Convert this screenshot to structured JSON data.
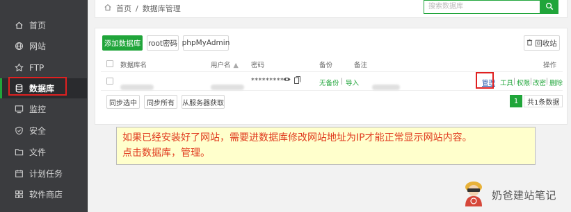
{
  "sidebar": {
    "items": [
      {
        "label": "首页",
        "icon": "home-icon"
      },
      {
        "label": "网站",
        "icon": "globe-icon"
      },
      {
        "label": "FTP",
        "icon": "ftp-icon"
      },
      {
        "label": "数据库",
        "icon": "database-icon",
        "active": true
      },
      {
        "label": "监控",
        "icon": "monitor-icon"
      },
      {
        "label": "安全",
        "icon": "shield-icon"
      },
      {
        "label": "文件",
        "icon": "folder-icon"
      },
      {
        "label": "计划任务",
        "icon": "calendar-icon"
      },
      {
        "label": "软件商店",
        "icon": "grid-icon"
      }
    ]
  },
  "breadcrumb": {
    "home": "首页",
    "separator": "/",
    "current": "数据库管理"
  },
  "search": {
    "placeholder": "搜索数据库"
  },
  "toolbar": {
    "add_db": "添加数据库",
    "root_pwd": "root密码",
    "phpmyadmin": "phpMyAdmin",
    "recycle": "回收站"
  },
  "table": {
    "headers": {
      "name": "数据库名",
      "user": "用户名",
      "password": "密码",
      "backup": "备份",
      "note": "备注",
      "actions": "操作"
    },
    "row": {
      "password": "**********",
      "backup_status": "无备份",
      "backup_sep": "|",
      "import": "导入",
      "actions": [
        "管理",
        "工具",
        "权限",
        "改密",
        "删除"
      ]
    }
  },
  "sync": {
    "selected": "同步选中",
    "all": "同步所有",
    "from_server": "从服务器获取"
  },
  "pager": {
    "page": "1",
    "total": "共1条数据"
  },
  "note": {
    "line1": "如果已经安装好了网站，需要进数据库修改网站地址为IP才能正常显示网站内容。",
    "line2": "点击数据库，管理。"
  },
  "watermark": {
    "text": "奶爸建站笔记"
  },
  "colors": {
    "brand_green": "#20a53a",
    "sidebar_bg": "#3b3c3f",
    "highlight_red": "#e02020",
    "note_bg": "#ffffcc",
    "note_text": "#e03a1e"
  }
}
